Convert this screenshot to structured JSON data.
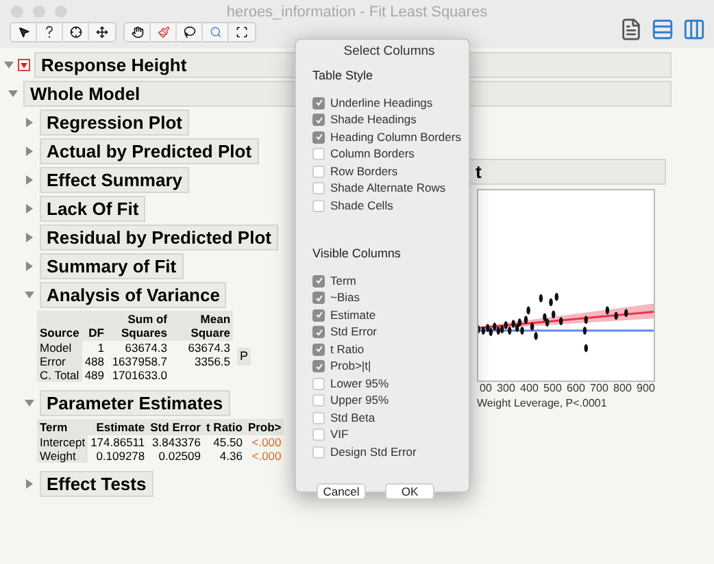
{
  "window": {
    "title": "heroes_information - Fit Least Squares"
  },
  "report": {
    "title": "Response Height",
    "expanded": true,
    "children": [
      {
        "title": "Whole Model",
        "expanded": true,
        "children": [
          {
            "title": "Regression Plot",
            "expanded": false
          },
          {
            "title": "Actual by Predicted Plot",
            "expanded": false
          },
          {
            "title": "Effect Summary",
            "expanded": false
          },
          {
            "title": "Lack Of Fit",
            "expanded": false
          },
          {
            "title": "Residual by Predicted Plot",
            "expanded": false
          },
          {
            "title": "Summary of Fit",
            "expanded": false
          },
          {
            "title": "Analysis of Variance",
            "expanded": true,
            "table": {
              "wrap_headers": true,
              "columns": [
                "Source",
                "DF",
                "Sum of Squares",
                "Mean Square"
              ],
              "rows": [
                [
                  "Model",
                  "1",
                  "63674.3",
                  "63674.3"
                ],
                [
                  "Error",
                  "488",
                  "1637958.7",
                  "3356.5"
                ],
                [
                  "C. Total",
                  "489",
                  "1701633.0",
                  ""
                ]
              ],
              "cut_cell": "P"
            }
          },
          {
            "title": "Parameter Estimates",
            "expanded": true,
            "table": {
              "columns": [
                "Term",
                "Estimate",
                "Std Error",
                "t Ratio",
                "Prob>"
              ],
              "rows": [
                [
                  "Intercept",
                  "174.86511",
                  "3.843376",
                  "45.50",
                  "<.000"
                ],
                [
                  "Weight",
                  "0.109278",
                  "0.02509",
                  "4.36",
                  "<.000"
                ]
              ]
            }
          },
          {
            "title": "Effect Tests",
            "expanded": false
          }
        ]
      }
    ]
  },
  "plot": {
    "title": "t",
    "xticks": [
      "00",
      "300",
      "400",
      "500",
      "600",
      "700",
      "800",
      "900"
    ],
    "xlabel": "Weight Leverage, P<.0001"
  },
  "dialog": {
    "title": "Select Columns",
    "sections": [
      {
        "title": "Table Style",
        "options": [
          {
            "label": "Underline Headings",
            "checked": true
          },
          {
            "label": "Shade Headings",
            "checked": true
          },
          {
            "label": "Heading Column Borders",
            "checked": true
          },
          {
            "label": "Column Borders",
            "checked": false
          },
          {
            "label": "Row Borders",
            "checked": false
          },
          {
            "label": "Shade Alternate Rows",
            "checked": false
          },
          {
            "label": "Shade Cells",
            "checked": false
          }
        ]
      },
      {
        "title": "Visible Columns",
        "options": [
          {
            "label": "Term",
            "checked": true
          },
          {
            "label": "~Bias",
            "checked": true
          },
          {
            "label": "Estimate",
            "checked": true
          },
          {
            "label": "Std Error",
            "checked": true
          },
          {
            "label": "t Ratio",
            "checked": true
          },
          {
            "label": "Prob>|t|",
            "checked": true
          },
          {
            "label": "Lower 95%",
            "checked": false
          },
          {
            "label": "Upper 95%",
            "checked": false
          },
          {
            "label": "Std Beta",
            "checked": false
          },
          {
            "label": "VIF",
            "checked": false
          },
          {
            "label": "Design Std Error",
            "checked": false
          }
        ]
      }
    ],
    "buttons": [
      "Cancel",
      "OK"
    ]
  }
}
